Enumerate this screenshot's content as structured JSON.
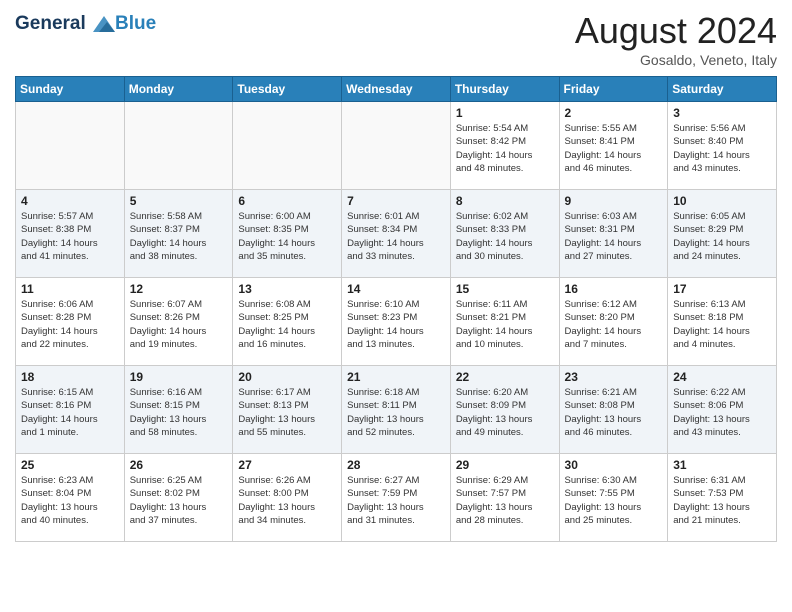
{
  "header": {
    "logo_line1": "General",
    "logo_line2": "Blue",
    "month_year": "August 2024",
    "location": "Gosaldo, Veneto, Italy"
  },
  "days_of_week": [
    "Sunday",
    "Monday",
    "Tuesday",
    "Wednesday",
    "Thursday",
    "Friday",
    "Saturday"
  ],
  "weeks": [
    [
      {
        "day": "",
        "info": ""
      },
      {
        "day": "",
        "info": ""
      },
      {
        "day": "",
        "info": ""
      },
      {
        "day": "",
        "info": ""
      },
      {
        "day": "1",
        "info": "Sunrise: 5:54 AM\nSunset: 8:42 PM\nDaylight: 14 hours\nand 48 minutes."
      },
      {
        "day": "2",
        "info": "Sunrise: 5:55 AM\nSunset: 8:41 PM\nDaylight: 14 hours\nand 46 minutes."
      },
      {
        "day": "3",
        "info": "Sunrise: 5:56 AM\nSunset: 8:40 PM\nDaylight: 14 hours\nand 43 minutes."
      }
    ],
    [
      {
        "day": "4",
        "info": "Sunrise: 5:57 AM\nSunset: 8:38 PM\nDaylight: 14 hours\nand 41 minutes."
      },
      {
        "day": "5",
        "info": "Sunrise: 5:58 AM\nSunset: 8:37 PM\nDaylight: 14 hours\nand 38 minutes."
      },
      {
        "day": "6",
        "info": "Sunrise: 6:00 AM\nSunset: 8:35 PM\nDaylight: 14 hours\nand 35 minutes."
      },
      {
        "day": "7",
        "info": "Sunrise: 6:01 AM\nSunset: 8:34 PM\nDaylight: 14 hours\nand 33 minutes."
      },
      {
        "day": "8",
        "info": "Sunrise: 6:02 AM\nSunset: 8:33 PM\nDaylight: 14 hours\nand 30 minutes."
      },
      {
        "day": "9",
        "info": "Sunrise: 6:03 AM\nSunset: 8:31 PM\nDaylight: 14 hours\nand 27 minutes."
      },
      {
        "day": "10",
        "info": "Sunrise: 6:05 AM\nSunset: 8:29 PM\nDaylight: 14 hours\nand 24 minutes."
      }
    ],
    [
      {
        "day": "11",
        "info": "Sunrise: 6:06 AM\nSunset: 8:28 PM\nDaylight: 14 hours\nand 22 minutes."
      },
      {
        "day": "12",
        "info": "Sunrise: 6:07 AM\nSunset: 8:26 PM\nDaylight: 14 hours\nand 19 minutes."
      },
      {
        "day": "13",
        "info": "Sunrise: 6:08 AM\nSunset: 8:25 PM\nDaylight: 14 hours\nand 16 minutes."
      },
      {
        "day": "14",
        "info": "Sunrise: 6:10 AM\nSunset: 8:23 PM\nDaylight: 14 hours\nand 13 minutes."
      },
      {
        "day": "15",
        "info": "Sunrise: 6:11 AM\nSunset: 8:21 PM\nDaylight: 14 hours\nand 10 minutes."
      },
      {
        "day": "16",
        "info": "Sunrise: 6:12 AM\nSunset: 8:20 PM\nDaylight: 14 hours\nand 7 minutes."
      },
      {
        "day": "17",
        "info": "Sunrise: 6:13 AM\nSunset: 8:18 PM\nDaylight: 14 hours\nand 4 minutes."
      }
    ],
    [
      {
        "day": "18",
        "info": "Sunrise: 6:15 AM\nSunset: 8:16 PM\nDaylight: 14 hours\nand 1 minute."
      },
      {
        "day": "19",
        "info": "Sunrise: 6:16 AM\nSunset: 8:15 PM\nDaylight: 13 hours\nand 58 minutes."
      },
      {
        "day": "20",
        "info": "Sunrise: 6:17 AM\nSunset: 8:13 PM\nDaylight: 13 hours\nand 55 minutes."
      },
      {
        "day": "21",
        "info": "Sunrise: 6:18 AM\nSunset: 8:11 PM\nDaylight: 13 hours\nand 52 minutes."
      },
      {
        "day": "22",
        "info": "Sunrise: 6:20 AM\nSunset: 8:09 PM\nDaylight: 13 hours\nand 49 minutes."
      },
      {
        "day": "23",
        "info": "Sunrise: 6:21 AM\nSunset: 8:08 PM\nDaylight: 13 hours\nand 46 minutes."
      },
      {
        "day": "24",
        "info": "Sunrise: 6:22 AM\nSunset: 8:06 PM\nDaylight: 13 hours\nand 43 minutes."
      }
    ],
    [
      {
        "day": "25",
        "info": "Sunrise: 6:23 AM\nSunset: 8:04 PM\nDaylight: 13 hours\nand 40 minutes."
      },
      {
        "day": "26",
        "info": "Sunrise: 6:25 AM\nSunset: 8:02 PM\nDaylight: 13 hours\nand 37 minutes."
      },
      {
        "day": "27",
        "info": "Sunrise: 6:26 AM\nSunset: 8:00 PM\nDaylight: 13 hours\nand 34 minutes."
      },
      {
        "day": "28",
        "info": "Sunrise: 6:27 AM\nSunset: 7:59 PM\nDaylight: 13 hours\nand 31 minutes."
      },
      {
        "day": "29",
        "info": "Sunrise: 6:29 AM\nSunset: 7:57 PM\nDaylight: 13 hours\nand 28 minutes."
      },
      {
        "day": "30",
        "info": "Sunrise: 6:30 AM\nSunset: 7:55 PM\nDaylight: 13 hours\nand 25 minutes."
      },
      {
        "day": "31",
        "info": "Sunrise: 6:31 AM\nSunset: 7:53 PM\nDaylight: 13 hours\nand 21 minutes."
      }
    ]
  ]
}
